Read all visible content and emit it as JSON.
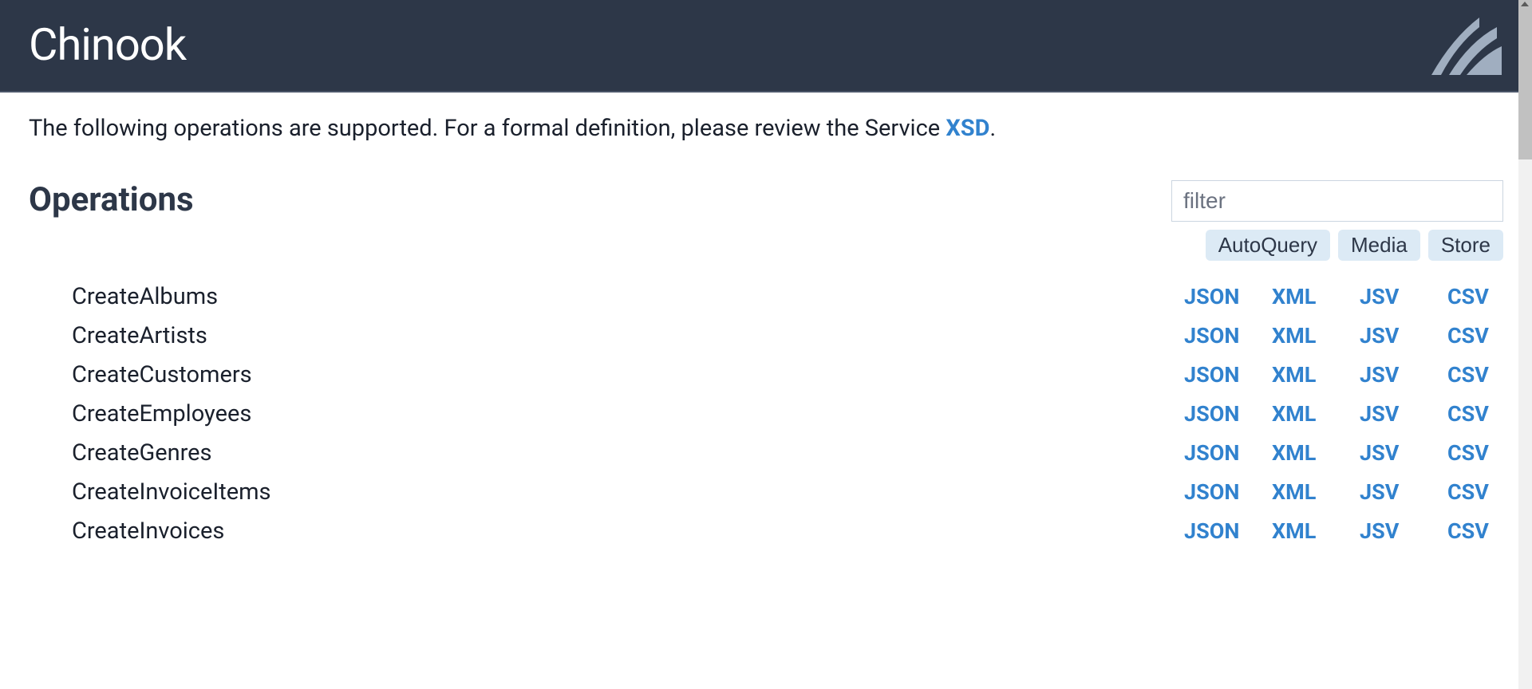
{
  "header": {
    "title": "Chinook"
  },
  "intro": {
    "prefix": "The following operations are supported. For a formal definition, please review the Service ",
    "link_label": "XSD",
    "suffix": "."
  },
  "operations": {
    "title": "Operations",
    "filter_placeholder": "filter",
    "chips": [
      "AutoQuery",
      "Media",
      "Store"
    ],
    "format_labels": [
      "JSON",
      "XML",
      "JSV",
      "CSV"
    ],
    "items": [
      {
        "name": "CreateAlbums"
      },
      {
        "name": "CreateArtists"
      },
      {
        "name": "CreateCustomers"
      },
      {
        "name": "CreateEmployees"
      },
      {
        "name": "CreateGenres"
      },
      {
        "name": "CreateInvoiceItems"
      },
      {
        "name": "CreateInvoices"
      }
    ]
  },
  "colors": {
    "header_bg": "#2d3748",
    "link": "#3182ce",
    "chip_bg": "#dceaf5"
  }
}
